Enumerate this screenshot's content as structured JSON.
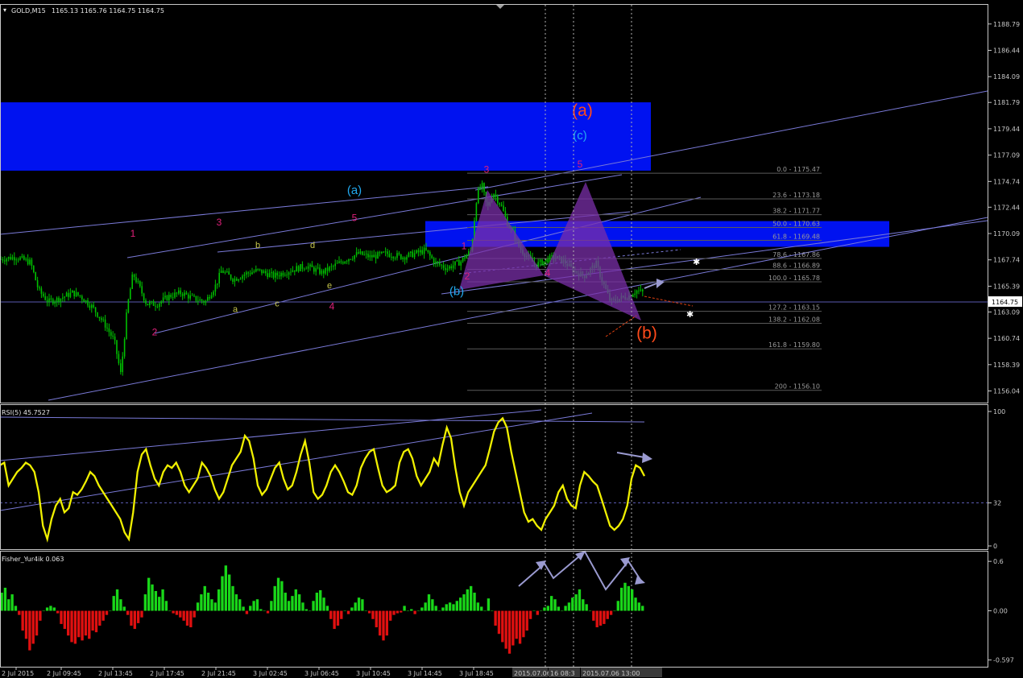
{
  "header": {
    "symbol": "GOLD,M15",
    "ohlc": "1165.13 1165.76 1164.75 1164.75",
    "rsi_label": "RSI(5) 45.7527",
    "fisher_label": "Fisher_Yur4ik 0.063"
  },
  "colors": {
    "background": "#000000",
    "grid": "#2a2a2a",
    "candle": "#00c000",
    "zone": "#0012f0",
    "trendline": "#7a7ad8",
    "rsi": "#f0f000",
    "fisher_pos": "#19d719",
    "fisher_neg": "#e01010",
    "pattern": "#7a2fa8",
    "wave_magenta": "#e0207a",
    "wave_cyan": "#22aaf0",
    "wave_orange": "#ff4a1a",
    "wave_olive": "#c4c44a"
  },
  "chart_data": [
    {
      "type": "candlestick",
      "title": "GOLD,M15",
      "ylim": [
        1155.0,
        1191.0
      ],
      "yticks": [
        "1188.79",
        "1186.44",
        "1184.09",
        "1181.79",
        "1179.44",
        "1177.09",
        "1174.74",
        "1172.44",
        "1170.09",
        "1167.74",
        "1165.39",
        "1163.09",
        "1160.74",
        "1158.39",
        "1156.04"
      ],
      "current_price": "1164.75",
      "xticks": [
        "2 Jul 2015",
        "2 Jul 09:45",
        "2 Jul 13:45",
        "2 Jul 17:45",
        "2 Jul 21:45",
        "3 Jul 02:45",
        "3 Jul 06:45",
        "3 Jul 10:45",
        "3 Jul 14:45",
        "3 Jul 18:45"
      ],
      "date_markers": [
        "2015.07.06 06:15",
        "16 08:3",
        "2015.07.06 13:00"
      ],
      "price_path": [
        [
          0,
          1167.8
        ],
        [
          20,
          1168.0
        ],
        [
          38,
          1167.5
        ],
        [
          48,
          1165.0
        ],
        [
          60,
          1164.0
        ],
        [
          75,
          1164.3
        ],
        [
          90,
          1164.8
        ],
        [
          100,
          1164.5
        ],
        [
          115,
          1163.5
        ],
        [
          130,
          1162.0
        ],
        [
          142,
          1160.5
        ],
        [
          150,
          1157.5
        ],
        [
          158,
          1163.5
        ],
        [
          165,
          1166.5
        ],
        [
          172,
          1165.5
        ],
        [
          182,
          1163.8
        ],
        [
          195,
          1163.8
        ],
        [
          210,
          1164.5
        ],
        [
          225,
          1164.8
        ],
        [
          240,
          1164.3
        ],
        [
          255,
          1164.0
        ],
        [
          268,
          1165.5
        ],
        [
          275,
          1166.8
        ],
        [
          290,
          1166.0
        ],
        [
          305,
          1166.5
        ],
        [
          320,
          1166.8
        ],
        [
          340,
          1166.3
        ],
        [
          360,
          1166.8
        ],
        [
          380,
          1167.2
        ],
        [
          400,
          1166.6
        ],
        [
          415,
          1167.2
        ],
        [
          430,
          1167.8
        ],
        [
          445,
          1168.3
        ],
        [
          460,
          1168.0
        ],
        [
          480,
          1168.3
        ],
        [
          500,
          1168.0
        ],
        [
          515,
          1168.3
        ],
        [
          528,
          1168.6
        ],
        [
          540,
          1167.5
        ],
        [
          555,
          1167.0
        ],
        [
          572,
          1167.6
        ],
        [
          585,
          1168.6
        ],
        [
          592,
          1173.5
        ],
        [
          598,
          1174.5
        ],
        [
          605,
          1172.3
        ],
        [
          612,
          1173.8
        ],
        [
          622,
          1172.6
        ],
        [
          630,
          1171.0
        ],
        [
          638,
          1170.0
        ],
        [
          645,
          1168.8
        ],
        [
          655,
          1168.0
        ],
        [
          665,
          1167.3
        ],
        [
          675,
          1167.6
        ],
        [
          688,
          1168.0
        ],
        [
          700,
          1167.6
        ],
        [
          712,
          1166.8
        ],
        [
          725,
          1166.3
        ],
        [
          740,
          1167.4
        ],
        [
          748,
          1165.8
        ],
        [
          758,
          1164.0
        ],
        [
          770,
          1164.3
        ],
        [
          780,
          1164.5
        ],
        [
          790,
          1165.0
        ],
        [
          800,
          1164.8
        ]
      ],
      "resistance_zones": [
        {
          "from": 1175.7,
          "to": 1181.8
        },
        {
          "from": 1168.9,
          "to": 1171.2
        }
      ],
      "fibonacci_levels": [
        {
          "label": "0.0 - 1175.47",
          "price": 1175.47
        },
        {
          "label": "23.6 - 1173.18",
          "price": 1173.18
        },
        {
          "label": "38.2 - 1171.77",
          "price": 1171.77
        },
        {
          "label": "50.0 - 1170.63",
          "price": 1170.63
        },
        {
          "label": "61.8 - 1169.48",
          "price": 1169.48
        },
        {
          "label": "78.6 - 1167.86",
          "price": 1167.86
        },
        {
          "label": "88.6 - 1166.89",
          "price": 1166.89
        },
        {
          "label": "100.0 - 1165.78",
          "price": 1165.78
        },
        {
          "label": "127.2 - 1163.15",
          "price": 1163.15
        },
        {
          "label": "138.2 - 1162.08",
          "price": 1162.08
        },
        {
          "label": "161.8 - 1159.80",
          "price": 1159.8
        },
        {
          "label": "200 - 1156.10",
          "price": 1156.1
        }
      ],
      "wave_labels": [
        {
          "text": "1",
          "x": 165,
          "price": 1169.8,
          "color": "wave_magenta",
          "size": 12
        },
        {
          "text": "2",
          "x": 192,
          "price": 1161.0,
          "color": "wave_magenta",
          "size": 12
        },
        {
          "text": "3",
          "x": 272,
          "price": 1170.8,
          "color": "wave_magenta",
          "size": 12
        },
        {
          "text": "4",
          "x": 412,
          "price": 1163.3,
          "color": "wave_magenta",
          "size": 12
        },
        {
          "text": "5",
          "x": 440,
          "price": 1171.2,
          "color": "wave_magenta",
          "size": 12
        },
        {
          "text": "a",
          "x": 292,
          "price": 1163.1,
          "color": "wave_olive",
          "size": 11
        },
        {
          "text": "b",
          "x": 320,
          "price": 1168.8,
          "color": "wave_olive",
          "size": 11
        },
        {
          "text": "c",
          "x": 344,
          "price": 1163.6,
          "color": "wave_olive",
          "size": 11
        },
        {
          "text": "d",
          "x": 388,
          "price": 1168.8,
          "color": "wave_olive",
          "size": 11
        },
        {
          "text": "e",
          "x": 409,
          "price": 1165.2,
          "color": "wave_olive",
          "size": 11
        },
        {
          "text": "(a)",
          "x": 440,
          "price": 1173.6,
          "color": "wave_cyan",
          "size": 15
        },
        {
          "text": "(b)",
          "x": 567,
          "price": 1164.6,
          "color": "wave_cyan",
          "size": 15
        },
        {
          "text": "(c)",
          "x": 720,
          "price": 1178.5,
          "color": "wave_cyan",
          "size": 15
        },
        {
          "text": "(a)",
          "x": 723,
          "price": 1180.6,
          "color": "wave_orange",
          "size": 21
        },
        {
          "text": "(b)",
          "x": 803,
          "price": 1160.7,
          "color": "wave_orange",
          "size": 21
        },
        {
          "text": "1",
          "x": 576,
          "price": 1168.7,
          "color": "wave_magenta",
          "size": 12
        },
        {
          "text": "2",
          "x": 580,
          "price": 1166.0,
          "color": "wave_magenta",
          "size": 12
        },
        {
          "text": "3",
          "x": 604,
          "price": 1175.5,
          "color": "wave_magenta",
          "size": 12
        },
        {
          "text": "4",
          "x": 680,
          "price": 1166.3,
          "color": "wave_magenta",
          "size": 12
        },
        {
          "text": "5",
          "x": 720,
          "price": 1176.0,
          "color": "wave_magenta",
          "size": 12
        }
      ]
    },
    {
      "type": "line",
      "title": "RSI(5) 45.7527",
      "ylim": [
        0,
        100
      ],
      "yticks": [
        "100",
        "32",
        "0"
      ],
      "level": 32,
      "values": [
        60,
        62,
        45,
        50,
        55,
        58,
        62,
        60,
        55,
        40,
        15,
        5,
        20,
        30,
        35,
        25,
        28,
        40,
        38,
        42,
        48,
        55,
        52,
        45,
        40,
        35,
        30,
        25,
        20,
        10,
        5,
        25,
        55,
        68,
        72,
        60,
        50,
        45,
        55,
        60,
        58,
        62,
        55,
        45,
        40,
        45,
        50,
        62,
        58,
        52,
        42,
        35,
        40,
        50,
        60,
        65,
        70,
        82,
        78,
        65,
        45,
        38,
        42,
        50,
        58,
        62,
        50,
        42,
        45,
        55,
        68,
        78,
        62,
        40,
        35,
        38,
        45,
        55,
        60,
        55,
        48,
        40,
        38,
        45,
        58,
        65,
        70,
        72,
        58,
        45,
        40,
        42,
        45,
        62,
        70,
        72,
        65,
        52,
        45,
        50,
        55,
        65,
        60,
        75,
        88,
        80,
        58,
        40,
        30,
        40,
        45,
        50,
        55,
        60,
        72,
        85,
        92,
        95,
        88,
        70,
        55,
        40,
        25,
        18,
        20,
        15,
        12,
        20,
        25,
        30,
        40,
        45,
        35,
        30,
        28,
        45,
        55,
        52,
        48,
        45,
        35,
        25,
        15,
        12,
        15,
        20,
        30,
        50,
        60,
        58,
        52
      ],
      "x_end": 800
    },
    {
      "type": "bar",
      "title": "Fisher_Yur4ik 0.063",
      "ylim": [
        -0.62,
        0.66
      ],
      "yticks": [
        "0.6",
        "0.00",
        "-0.597"
      ],
      "values": [
        0.22,
        0.28,
        0.14,
        0.2,
        0.06,
        -0.05,
        -0.24,
        -0.34,
        -0.48,
        -0.4,
        -0.3,
        -0.12,
        0.0,
        0.04,
        0.06,
        0.04,
        -0.03,
        -0.16,
        -0.22,
        -0.3,
        -0.38,
        -0.4,
        -0.32,
        -0.36,
        -0.3,
        -0.34,
        -0.24,
        -0.26,
        -0.18,
        -0.12,
        -0.05,
        0.0,
        0.18,
        0.26,
        0.14,
        0.05,
        -0.05,
        -0.18,
        -0.22,
        -0.15,
        -0.08,
        0.2,
        0.4,
        0.32,
        0.24,
        0.17,
        0.26,
        0.12,
        0.0,
        -0.03,
        -0.05,
        -0.08,
        -0.12,
        -0.18,
        -0.2,
        -0.08,
        0.1,
        0.2,
        0.3,
        0.22,
        0.14,
        0.1,
        0.26,
        0.42,
        0.55,
        0.44,
        0.3,
        0.2,
        0.14,
        0.05,
        -0.04,
        0.06,
        0.12,
        0.14,
        0.02,
        0.0,
        -0.03,
        0.12,
        0.3,
        0.4,
        0.36,
        0.22,
        0.12,
        0.18,
        0.26,
        0.2,
        0.1,
        0.02,
        0.0,
        0.12,
        0.22,
        0.25,
        0.16,
        0.06,
        -0.1,
        -0.22,
        -0.18,
        -0.1,
        0.0,
        -0.04,
        0.04,
        0.1,
        0.16,
        0.14,
        0.0,
        -0.03,
        -0.1,
        -0.2,
        -0.3,
        -0.36,
        -0.3,
        -0.12,
        -0.05,
        -0.03,
        -0.02,
        0.06,
        0.0,
        0.02,
        -0.04,
        0.0,
        0.04,
        0.1,
        0.2,
        0.14,
        0.06,
        0.0,
        0.04,
        0.08,
        0.1,
        0.08,
        0.12,
        0.16,
        0.2,
        0.26,
        0.3,
        0.22,
        0.1,
        0.05,
        0.0,
        0.15,
        0.0,
        -0.18,
        -0.28,
        -0.38,
        -0.46,
        -0.52,
        -0.42,
        -0.34,
        -0.4,
        -0.32,
        -0.24,
        -0.1,
        0.0,
        -0.05,
        0.0,
        0.04,
        0.06,
        0.18,
        0.14,
        0.05,
        0.0,
        0.06,
        0.1,
        0.16,
        0.2,
        0.26,
        0.14,
        0.08,
        0.0,
        -0.12,
        -0.2,
        -0.18,
        -0.16,
        -0.1,
        -0.05,
        0.0,
        0.12,
        0.28,
        0.34,
        0.3,
        0.26,
        0.16,
        0.1,
        0.06
      ],
      "x_end": 800
    }
  ]
}
